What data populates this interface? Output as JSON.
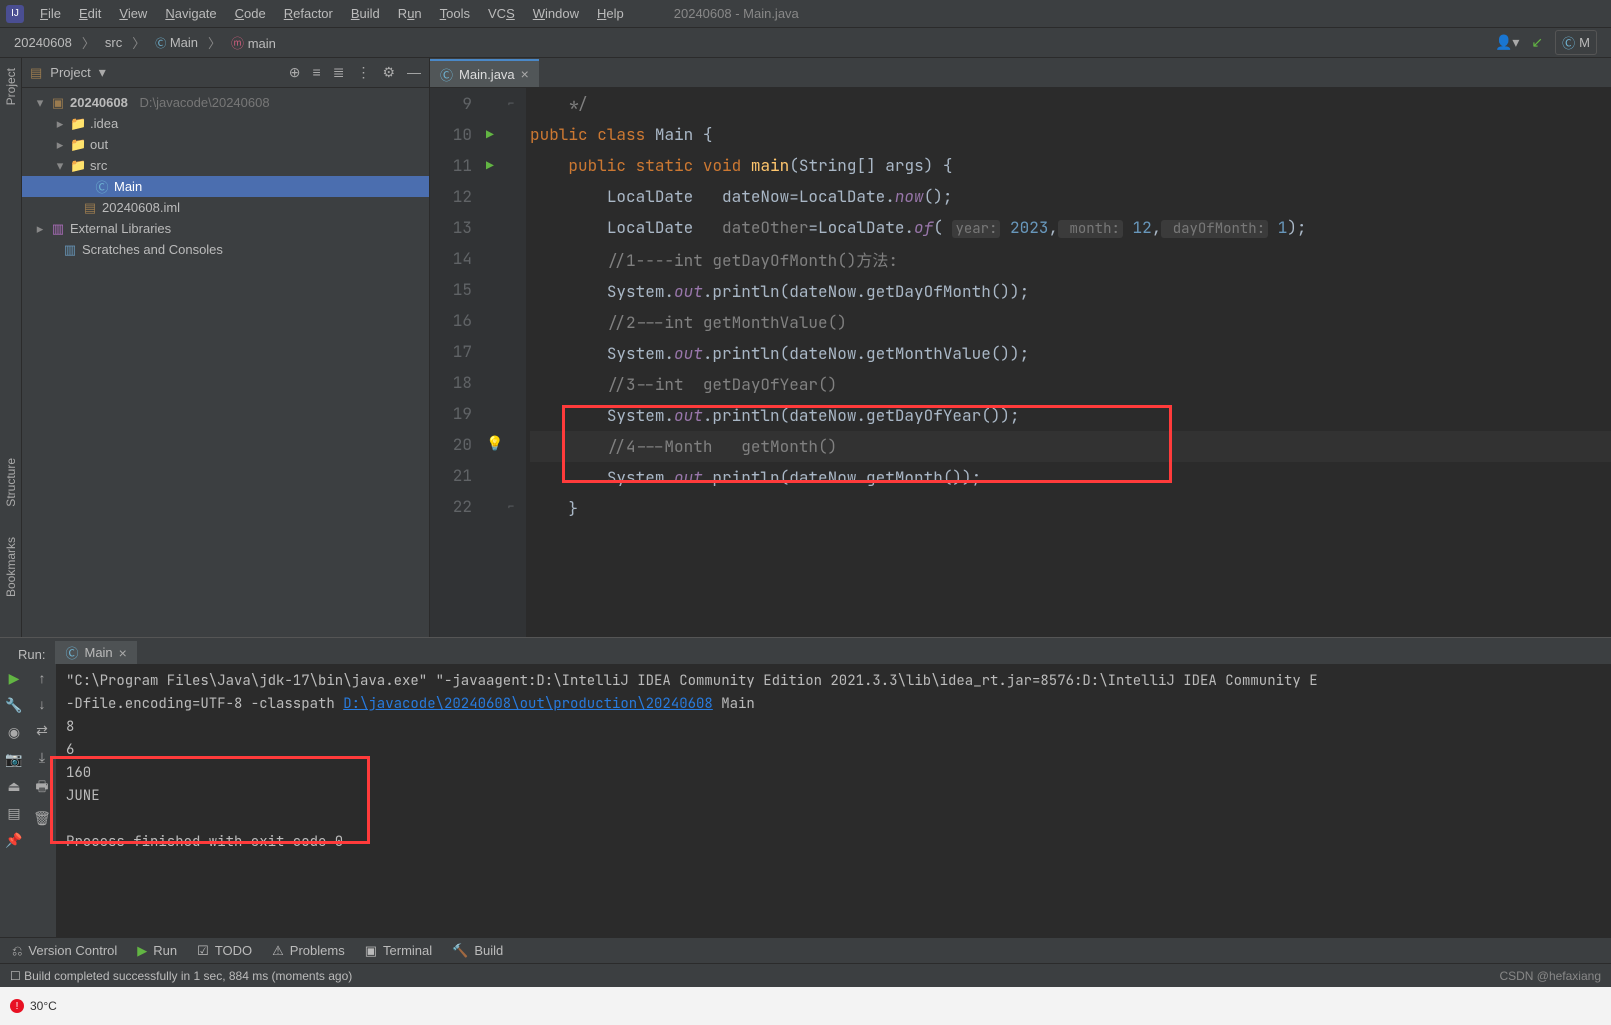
{
  "menu": {
    "file": "File",
    "edit": "Edit",
    "view": "View",
    "navigate": "Navigate",
    "code": "Code",
    "refactor": "Refactor",
    "build": "Build",
    "run": "Run",
    "tools": "Tools",
    "vcs": "VCS",
    "window": "Window",
    "help": "Help"
  },
  "title": "20240608 - Main.java",
  "breadcrumb": {
    "project": "20240608",
    "src": "src",
    "class": "Main",
    "method": "main"
  },
  "project_panel": {
    "title": "Project",
    "root": "20240608",
    "root_path": "D:\\javacode\\20240608",
    "idea": ".idea",
    "out": "out",
    "src": "src",
    "main": "Main",
    "iml": "20240608.iml",
    "ext": "External Libraries",
    "scratch": "Scratches and Consoles"
  },
  "editor": {
    "tab": "Main.java",
    "lines": [
      9,
      10,
      11,
      12,
      13,
      14,
      15,
      16,
      17,
      18,
      19,
      20,
      21,
      22
    ],
    "code": {
      "l9": "    */",
      "l10_kw1": "public",
      "l10_kw2": "class",
      "l10_name": "Main",
      "l10_brace": " {",
      "l11_kw1": "public",
      "l11_kw2": "static",
      "l11_kw3": "void",
      "l11_name": "main",
      "l11_args": "(String[] args) {",
      "l12_a": "LocalDate   dateNow=LocalDate.",
      "l12_b": "now",
      "l12_c": "();",
      "l13_a": "LocalDate   ",
      "l13_b": "dateOther",
      "l13_c": "=LocalDate.",
      "l13_d": "of",
      "l13_e": "(",
      "l13_h1": "year:",
      "l13_v1": " 2023",
      "l13_s1": ",",
      "l13_h2": " month:",
      "l13_v2": " 12",
      "l13_s2": ",",
      "l13_h3": " dayOfMonth:",
      "l13_v3": " 1",
      "l13_f": ");",
      "l14": "//1----int getDayOfMonth()方法:",
      "l15_a": "System.",
      "l15_b": "out",
      "l15_c": ".println(dateNow.getDayOfMonth());",
      "l16": "//2---int getMonthValue()",
      "l17_a": "System.",
      "l17_b": "out",
      "l17_c": ".println(dateNow.getMonthValue());",
      "l18": "//3--int  getDayOfYear()",
      "l19_a": "System.",
      "l19_b": "out",
      "l19_c": ".println(dateNow.getDayOfYear());",
      "l20": "//4---Month   getMonth()",
      "l21_a": "System.",
      "l21_b": "out",
      "l21_c": ".println(dateNow.getMonth());",
      "l22": "}"
    }
  },
  "run": {
    "label": "Run:",
    "tab": "Main",
    "console_line1": "\"C:\\Program Files\\Java\\jdk-17\\bin\\java.exe\" \"-javaagent:D:\\IntelliJ IDEA Community Edition 2021.3.3\\lib\\idea_rt.jar=8576:D:\\IntelliJ IDEA Community E",
    "console_line2a": " -Dfile.encoding=UTF-8 -classpath ",
    "console_line2b": "D:\\javacode\\20240608\\out\\production\\20240608",
    "console_line2c": " Main",
    "out1": "8",
    "out2": "6",
    "out3": "160",
    "out4": "JUNE",
    "exit": "Process finished with exit code 0"
  },
  "bottom": {
    "vcs": "Version Control",
    "run": "Run",
    "todo": "TODO",
    "problems": "Problems",
    "terminal": "Terminal",
    "build": "Build"
  },
  "status": {
    "text": "Build completed successfully in 1 sec, 884 ms (moments ago)",
    "watermark": "CSDN @hefaxiang"
  },
  "sidebar": {
    "project": "Project",
    "structure": "Structure",
    "bookmarks": "Bookmarks"
  },
  "taskbar": {
    "temp": "30°C"
  },
  "nav_right": {
    "run_target": "M"
  }
}
